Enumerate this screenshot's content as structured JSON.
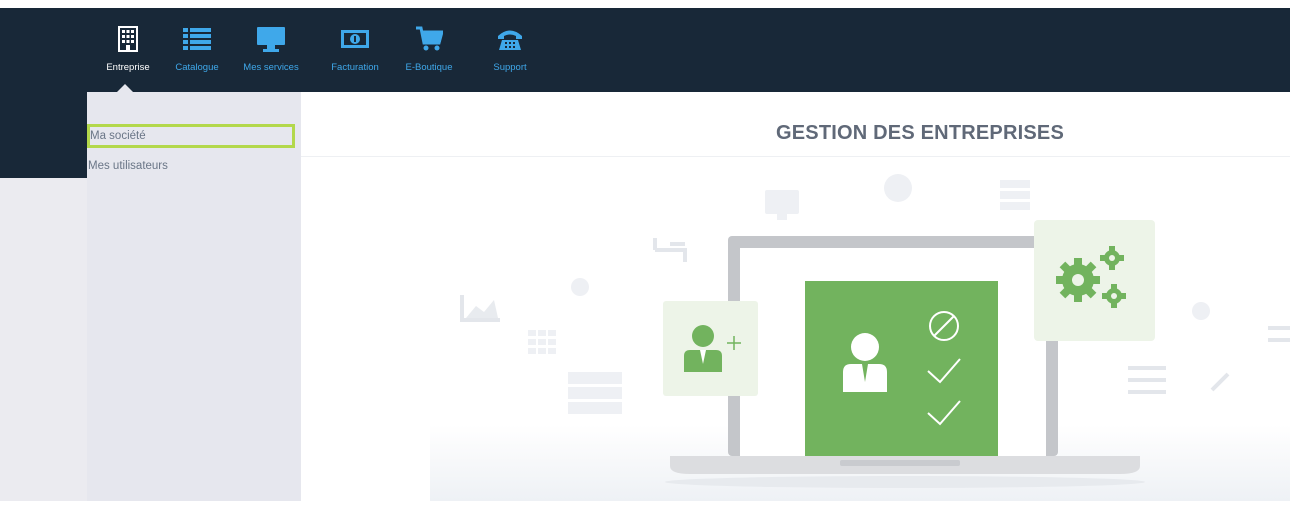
{
  "topnav": {
    "items": [
      {
        "label": "Entreprise",
        "icon": "building-icon",
        "active": true
      },
      {
        "label": "Catalogue",
        "icon": "list-icon",
        "active": false
      },
      {
        "label": "Mes services",
        "icon": "monitor-icon",
        "active": false
      },
      {
        "label": "Facturation",
        "icon": "banknote-icon",
        "active": false
      },
      {
        "label": "E-Boutique",
        "icon": "cart-icon",
        "active": false
      },
      {
        "label": "Support",
        "icon": "phone-icon",
        "active": false
      }
    ]
  },
  "submenu": {
    "items": [
      {
        "label": "Ma société",
        "highlighted": true
      },
      {
        "label": "Mes utilisateurs",
        "highlighted": false
      }
    ]
  },
  "main": {
    "title": "GESTION DES ENTREPRISES"
  },
  "colors": {
    "navbar": "#182838",
    "nav_label": "#3fa8ea",
    "submenu_bg": "#e6e7ee",
    "highlight_border": "#b3d84b",
    "illustration_green": "#72b35e"
  }
}
